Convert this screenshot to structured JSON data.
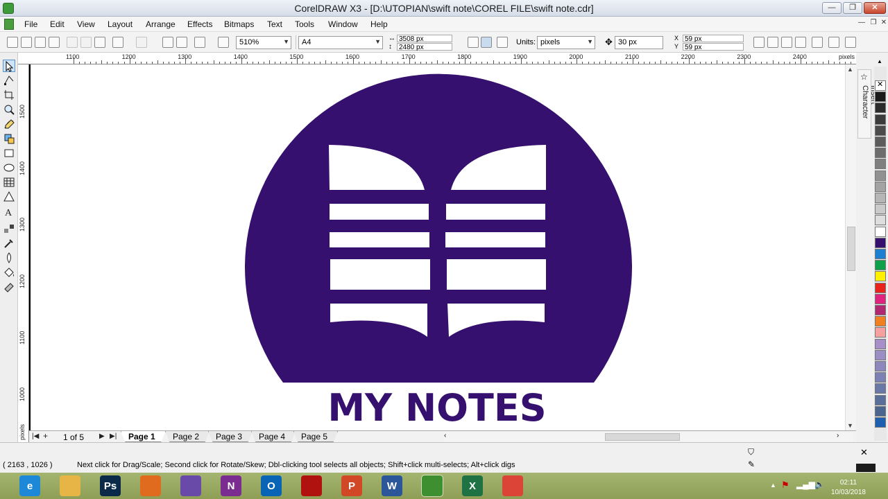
{
  "window": {
    "title": "CorelDRAW X3 - [D:\\UTOPIAN\\swift note\\COREL FILE\\swift note.cdr]",
    "min_label": "—",
    "restore_label": "❐",
    "close_label": "✕"
  },
  "menu": {
    "items": [
      {
        "label": "File"
      },
      {
        "label": "Edit"
      },
      {
        "label": "View"
      },
      {
        "label": "Layout"
      },
      {
        "label": "Arrange"
      },
      {
        "label": "Effects"
      },
      {
        "label": "Bitmaps"
      },
      {
        "label": "Text"
      },
      {
        "label": "Tools"
      },
      {
        "label": "Window"
      },
      {
        "label": "Help"
      }
    ]
  },
  "propbar": {
    "zoom": "510%",
    "paper": "A4",
    "width": "3508 px",
    "height": "2480 px",
    "units_label": "Units:",
    "units": "pixels",
    "nudge": "30 px",
    "dup_x": "59 px",
    "dup_y": "59 px"
  },
  "ruler": {
    "top_labels": [
      "1100",
      "1200",
      "1300",
      "1400",
      "1500",
      "1600",
      "1700",
      "1800",
      "1900",
      "2000",
      "2100",
      "2200",
      "2300",
      "2400"
    ],
    "top_unit": "pixels",
    "left_labels": [
      "1500",
      "1400",
      "1300",
      "1200",
      "1100",
      "1000"
    ],
    "left_unit": "pixels"
  },
  "logo": {
    "text": "MY NOTES",
    "color": "#35106f"
  },
  "dockers": {
    "insert_character": "Insert Character"
  },
  "palette": {
    "colors": [
      "#ffffff",
      "#1a1a1a",
      "#2b2b2b",
      "#3b3b3b",
      "#4b4b4b",
      "#5c5c5c",
      "#6d6d6d",
      "#7f7f7f",
      "#919191",
      "#a3a3a3",
      "#b6b6b6",
      "#cacaca",
      "#dedede",
      "#ffffff",
      "#35106f",
      "#1e7fd0",
      "#11a04a",
      "#ffef00",
      "#e8231b",
      "#e0237d",
      "#b0286f",
      "#f08020",
      "#f7a0a0",
      "#a98fc9",
      "#9b8ec4",
      "#8d87bd",
      "#7c80b4",
      "#6a78a8",
      "#5a6e9c",
      "#4b6590",
      "#1e5fb0"
    ]
  },
  "pagebar": {
    "counter": "1 of 5",
    "tabs": [
      "Page 1",
      "Page 2",
      "Page 3",
      "Page 4",
      "Page 5"
    ]
  },
  "status": {
    "coords": "( 2163 , 1026  )",
    "message": "Next click for Drag/Scale; Second click for Rotate/Skew; Dbl-clicking tool selects all objects; Shift+click multi-selects; Alt+click digs"
  },
  "taskbar": {
    "apps": [
      {
        "name": "internet-explorer",
        "label": "e",
        "color": "#1e88d8"
      },
      {
        "name": "file-explorer",
        "label": "",
        "color": "#e6b545"
      },
      {
        "name": "photoshop",
        "label": "Ps",
        "color": "#0b2a4a"
      },
      {
        "name": "firefox",
        "label": "",
        "color": "#e06b1f"
      },
      {
        "name": "visual-studio",
        "label": "",
        "color": "#6a4aa8"
      },
      {
        "name": "onenote",
        "label": "N",
        "color": "#7b2c91"
      },
      {
        "name": "outlook",
        "label": "O",
        "color": "#0a64b5"
      },
      {
        "name": "acrobat",
        "label": "",
        "color": "#b0120f"
      },
      {
        "name": "powerpoint",
        "label": "P",
        "color": "#d24726"
      },
      {
        "name": "word",
        "label": "W",
        "color": "#2b579a"
      },
      {
        "name": "coreldraw",
        "label": "",
        "color": "#3d8f2f"
      },
      {
        "name": "excel",
        "label": "X",
        "color": "#1f7244"
      },
      {
        "name": "chrome",
        "label": "",
        "color": "#db4437"
      }
    ],
    "time": "02:11",
    "date": "10/03/2018"
  }
}
